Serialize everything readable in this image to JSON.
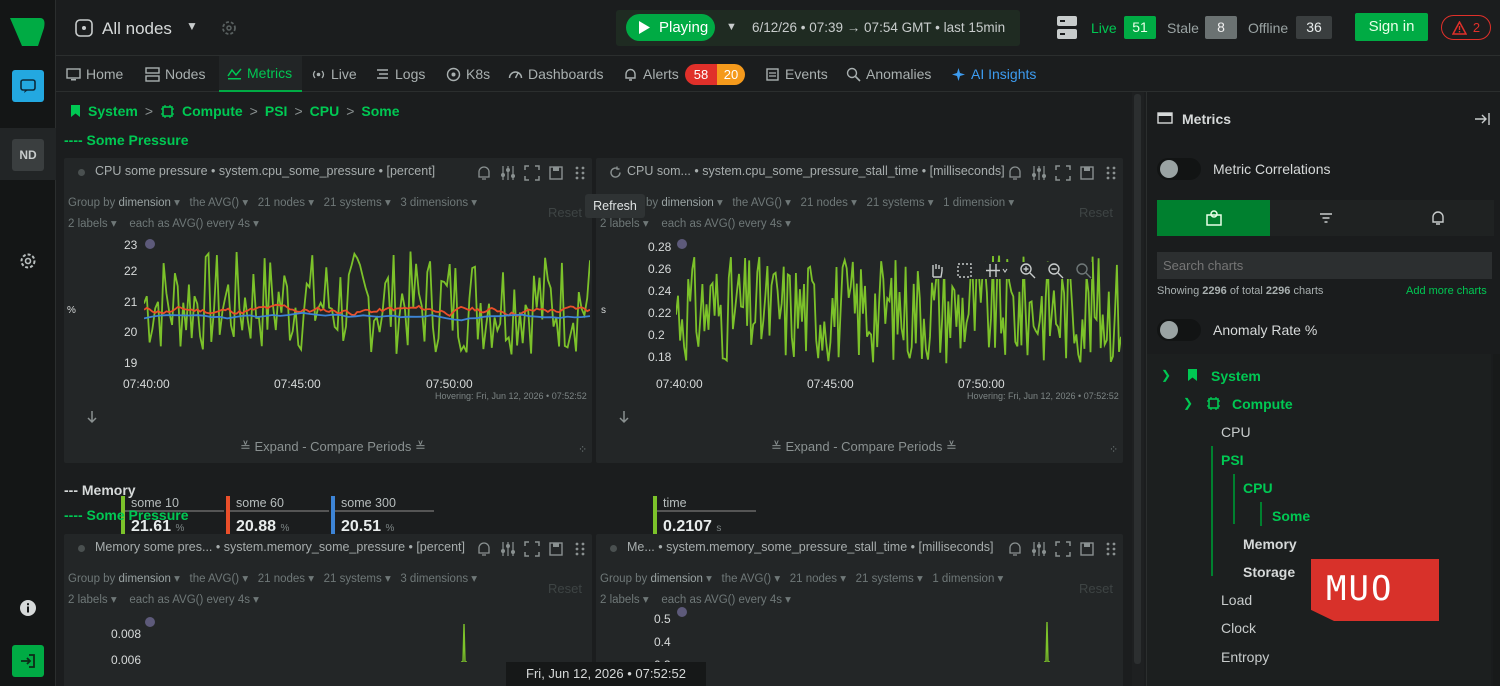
{
  "top": {
    "nodes_label": "All nodes",
    "play_label": "Playing",
    "time_range": "6/12/26 • 07:39 → 07:54 GMT • last  15min",
    "live_label": "Live",
    "live_count": "51",
    "stale_label": "Stale",
    "stale_count": "8",
    "offline_label": "Offline",
    "offline_count": "36",
    "signin_label": "Sign in",
    "alerts_count": "2"
  },
  "left": {
    "avatar": "ND"
  },
  "tabs": [
    {
      "label": "Home"
    },
    {
      "label": "Nodes"
    },
    {
      "label": "Metrics"
    },
    {
      "label": "Live"
    },
    {
      "label": "Logs"
    },
    {
      "label": "K8s"
    },
    {
      "label": "Dashboards"
    },
    {
      "label": "Alerts"
    },
    {
      "label": "Events"
    },
    {
      "label": "Anomalies"
    },
    {
      "label": "AI Insights"
    }
  ],
  "alert_badges": {
    "critical": "58",
    "warning": "20"
  },
  "breadcrumb": [
    "System",
    ">",
    "Compute",
    ">",
    "PSI",
    ">",
    "CPU",
    ">",
    "Some"
  ],
  "sections": {
    "some_pressure_1": "---- Some Pressure",
    "memory": "--- Memory",
    "some_pressure_2": "---- Some Pressure"
  },
  "charts": [
    {
      "title": "CPU some pressure • system.cpu_some_pressure • [percent]",
      "group_by": "Group by",
      "dimension": "dimension",
      "agg": "the AVG()",
      "nodes": "21 nodes",
      "systems": "21 systems",
      "dims": "3 dimensions",
      "labels": "2 labels",
      "each": "each as AVG() every 4s",
      "reset": "Reset",
      "unit": "%",
      "hover": "Hovering: Fri, Jun 12, 2026 • 07:52:52",
      "expand": "Expand - Compare Periods",
      "y_ticks": [
        "23",
        "22",
        "21",
        "20",
        "19"
      ],
      "x_ticks": [
        "07:40:00",
        "07:45:00",
        "07:50:00"
      ]
    },
    {
      "title": "CPU som... • system.cpu_some_pressure_stall_time • [milliseconds]",
      "group_by": "by",
      "dimension": "dimension",
      "agg": "the AVG()",
      "nodes": "21 nodes",
      "systems": "21 systems",
      "dims": "1 dimension",
      "labels": "2 labels",
      "each": "each as AVG() every 4s",
      "reset": "Reset",
      "unit": "s",
      "hover": "Hovering: Fri, Jun 12, 2026 • 07:52:52",
      "expand": "Expand - Compare Periods",
      "y_ticks": [
        "0.28",
        "0.26",
        "0.24",
        "0.22",
        "0.2",
        "0.18"
      ],
      "x_ticks": [
        "07:40:00",
        "07:45:00",
        "07:50:00"
      ]
    },
    {
      "title": "Memory some pres... • system.memory_some_pressure • [percent]",
      "group_by": "Group by",
      "dimension": "dimension",
      "agg": "the AVG()",
      "nodes": "21 nodes",
      "systems": "21 systems",
      "dims": "3 dimensions",
      "labels": "2 labels",
      "each": "each as AVG() every 4s",
      "reset": "Reset",
      "y_ticks": [
        "0.008",
        "0.006"
      ]
    },
    {
      "title": "Me... • system.memory_some_pressure_stall_time • [milliseconds]",
      "group_by": "Group by",
      "dimension": "dimension",
      "agg": "the AVG()",
      "nodes": "21 nodes",
      "systems": "21 systems",
      "dims": "1 dimension",
      "labels": "2 labels",
      "each": "each as AVG() every 4s",
      "reset": "Reset",
      "y_ticks": [
        "0.5",
        "0.4",
        "0.3"
      ]
    }
  ],
  "legend1": [
    {
      "name": "some 10",
      "value": "21.61",
      "unit": "%",
      "color": "#7cc22a"
    },
    {
      "name": "some 60",
      "value": "20.88",
      "unit": "%",
      "color": "#ea4f2a"
    },
    {
      "name": "some 300",
      "value": "20.51",
      "unit": "%",
      "color": "#3d84d6"
    }
  ],
  "legend2": [
    {
      "name": "time",
      "value": "0.2107",
      "unit": "s",
      "color": "#7cc22a"
    }
  ],
  "tooltip": "Refresh",
  "bottom_time": "Fri, Jun 12, 2026 • 07:52:52",
  "right": {
    "title": "Metrics",
    "correlations": "Metric Correlations",
    "search_placeholder": "Search charts",
    "showing_prefix": "Showing",
    "showing_shown": "2296",
    "showing_mid": "of total",
    "showing_total": "2296",
    "showing_suffix": "charts",
    "add_more": "Add more charts",
    "anomaly": "Anomaly Rate %",
    "tree": [
      "System",
      "Compute",
      "CPU",
      "PSI",
      "CPU",
      "Some",
      "Memory",
      "Storage",
      "Load",
      "Clock",
      "Entropy"
    ]
  },
  "watermark": "MUO",
  "colors": {
    "accent": "#00ab44",
    "green_line": "#7cc22a",
    "red_line": "#ea4f2a",
    "blue_line": "#3d84d6"
  },
  "chart_data": [
    {
      "type": "line",
      "title": "CPU some pressure",
      "ylabel": "%",
      "ylim": [
        19,
        23
      ],
      "x_range": [
        "07:39:00",
        "07:54:00"
      ],
      "series": [
        {
          "name": "some 10",
          "approx_range": [
            19.6,
            22.8
          ]
        },
        {
          "name": "some 60",
          "approx_range": [
            20.4,
            21.5
          ]
        },
        {
          "name": "some 300",
          "approx_range": [
            20.4,
            21.1
          ]
        }
      ]
    },
    {
      "type": "line",
      "title": "CPU some pressure stall time",
      "ylabel": "s",
      "ylim": [
        0.17,
        0.29
      ],
      "series": [
        {
          "name": "time",
          "approx_range": [
            0.18,
            0.28
          ]
        }
      ]
    }
  ]
}
